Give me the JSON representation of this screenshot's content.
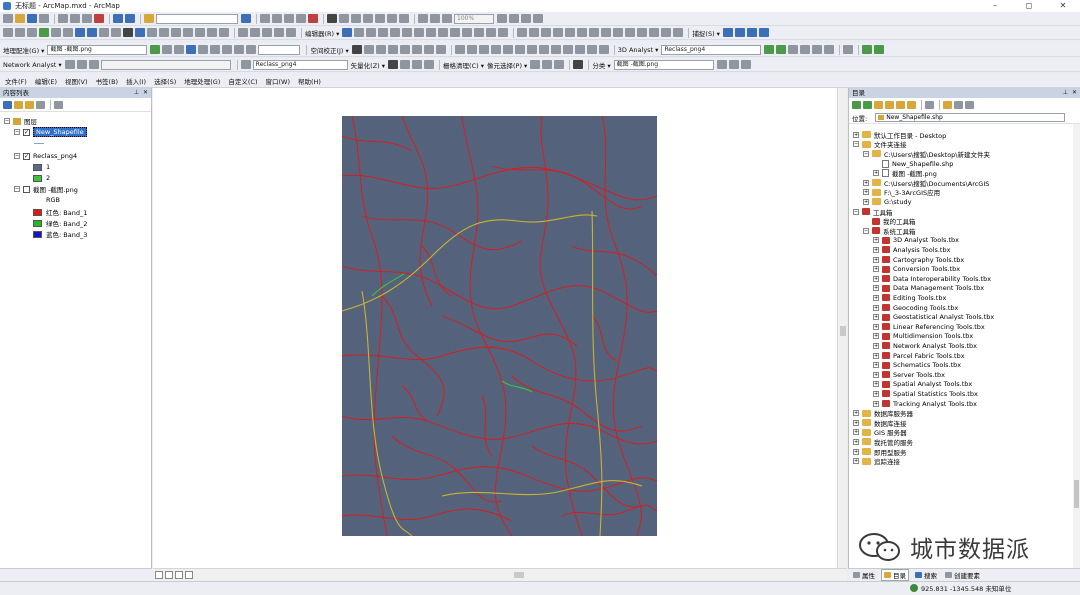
{
  "window": {
    "title": "无标题 - ArcMap.mxd - ArcMap",
    "controls": [
      "–",
      "◻",
      "✕"
    ]
  },
  "toolbar1": {
    "scale_box": "",
    "zoom_level": "100%"
  },
  "toolbar2": {
    "editor_label": "编辑器(R) ▾",
    "georef_label": "捕捉(S) ▾"
  },
  "toolbar3": {
    "georef_menu": "地理配准(G) ▾",
    "layer_box": "截图 -截图.png",
    "spatial_adjust": "空间校正(J) ▾",
    "analyst_3d": "3D Analyst ▾",
    "analyst_layer": "Reclass_png4"
  },
  "toolbar4": {
    "network_analyst": "Network Analyst ▾",
    "layer_box": "Reclass_png4",
    "vectorize": "矢量化(Z) ▾",
    "raster_cleanup": "栅格清理(C) ▾",
    "cell_select": "像元选择(P) ▾",
    "classify": "分类 ▾",
    "classify_layer": "截图 -截图.png"
  },
  "menubar": {
    "items": [
      "文件(F)",
      "编辑(E)",
      "视图(V)",
      "书签(B)",
      "插入(I)",
      "选择(S)",
      "地理处理(G)",
      "自定义(C)",
      "窗口(W)",
      "帮助(H)"
    ]
  },
  "toc": {
    "title": "内容列表",
    "layers_group": "图层",
    "layer1": "New_Shapefile",
    "layer2": "Reclass_png4",
    "layer2_classes": [
      {
        "label": "1",
        "color": "#5a6a86"
      },
      {
        "label": "2",
        "color": "#3dc43d"
      }
    ],
    "layer3": "截图 -截图.png",
    "rgb_label": "RGB",
    "bands": [
      {
        "label": "红色:    Band_1",
        "color": "#e01818"
      },
      {
        "label": "绿色:  Band_2",
        "color": "#22bb22"
      },
      {
        "label": "蓝色:    Band_3",
        "color": "#1414c8"
      }
    ]
  },
  "catalog": {
    "title": "目录",
    "location_label": "位置:",
    "location_value": "New_Shapefile.shp",
    "items": [
      {
        "label": "默认工作目录 - Desktop",
        "indent": 0,
        "icon": "folder",
        "exp": "+"
      },
      {
        "label": "文件夹连接",
        "indent": 0,
        "icon": "folder",
        "exp": "−"
      },
      {
        "label": "C:\\Users\\搜狐\\Desktop\\新建文件夹",
        "indent": 1,
        "icon": "folder",
        "exp": "−"
      },
      {
        "label": "New_Shapefile.shp",
        "indent": 2,
        "icon": "file",
        "exp": ""
      },
      {
        "label": "截图 -截图.png",
        "indent": 2,
        "icon": "file",
        "exp": "+"
      },
      {
        "label": "C:\\Users\\搜狐\\Documents\\ArcGIS",
        "indent": 1,
        "icon": "folder",
        "exp": "+"
      },
      {
        "label": "F:\\_3-3ArcGIS应用",
        "indent": 1,
        "icon": "folder",
        "exp": "+"
      },
      {
        "label": "G:\\study",
        "indent": 1,
        "icon": "folder",
        "exp": "+"
      },
      {
        "label": "工具箱",
        "indent": 0,
        "icon": "tbx",
        "exp": "−"
      },
      {
        "label": "我的工具箱",
        "indent": 1,
        "icon": "tbx",
        "exp": ""
      },
      {
        "label": "系统工具箱",
        "indent": 1,
        "icon": "tbx",
        "exp": "−"
      },
      {
        "label": "3D Analyst Tools.tbx",
        "indent": 2,
        "icon": "tbx",
        "exp": "+"
      },
      {
        "label": "Analysis Tools.tbx",
        "indent": 2,
        "icon": "tbx",
        "exp": "+"
      },
      {
        "label": "Cartography Tools.tbx",
        "indent": 2,
        "icon": "tbx",
        "exp": "+"
      },
      {
        "label": "Conversion Tools.tbx",
        "indent": 2,
        "icon": "tbx",
        "exp": "+"
      },
      {
        "label": "Data Interoperability Tools.tbx",
        "indent": 2,
        "icon": "tbx",
        "exp": "+"
      },
      {
        "label": "Data Management Tools.tbx",
        "indent": 2,
        "icon": "tbx",
        "exp": "+"
      },
      {
        "label": "Editing Tools.tbx",
        "indent": 2,
        "icon": "tbx",
        "exp": "+"
      },
      {
        "label": "Geocoding Tools.tbx",
        "indent": 2,
        "icon": "tbx",
        "exp": "+"
      },
      {
        "label": "Geostatistical Analyst Tools.tbx",
        "indent": 2,
        "icon": "tbx",
        "exp": "+"
      },
      {
        "label": "Linear Referencing Tools.tbx",
        "indent": 2,
        "icon": "tbx",
        "exp": "+"
      },
      {
        "label": "Multidimension Tools.tbx",
        "indent": 2,
        "icon": "tbx",
        "exp": "+"
      },
      {
        "label": "Network Analyst Tools.tbx",
        "indent": 2,
        "icon": "tbx",
        "exp": "+"
      },
      {
        "label": "Parcel Fabric Tools.tbx",
        "indent": 2,
        "icon": "tbx",
        "exp": "+"
      },
      {
        "label": "Schematics Tools.tbx",
        "indent": 2,
        "icon": "tbx",
        "exp": "+"
      },
      {
        "label": "Server Tools.tbx",
        "indent": 2,
        "icon": "tbx",
        "exp": "+"
      },
      {
        "label": "Spatial Analyst Tools.tbx",
        "indent": 2,
        "icon": "tbx",
        "exp": "+"
      },
      {
        "label": "Spatial Statistics Tools.tbx",
        "indent": 2,
        "icon": "tbx",
        "exp": "+"
      },
      {
        "label": "Tracking Analyst Tools.tbx",
        "indent": 2,
        "icon": "tbx",
        "exp": "+"
      },
      {
        "label": "数据库服务器",
        "indent": 0,
        "icon": "folder",
        "exp": "+"
      },
      {
        "label": "数据库连接",
        "indent": 0,
        "icon": "folder",
        "exp": "+"
      },
      {
        "label": "GIS 服务器",
        "indent": 0,
        "icon": "folder",
        "exp": "+"
      },
      {
        "label": "我托管的服务",
        "indent": 0,
        "icon": "folder",
        "exp": "+"
      },
      {
        "label": "即用型服务",
        "indent": 0,
        "icon": "folder",
        "exp": "+"
      },
      {
        "label": "追踪连接",
        "indent": 0,
        "icon": "folder",
        "exp": "+"
      }
    ],
    "tabs": [
      "属性",
      "目录",
      "搜索",
      "创建要素"
    ]
  },
  "status": {
    "coords": "925.831  -1345.548 未知单位"
  },
  "watermark": {
    "text": "城市数据派"
  },
  "colors": {
    "map_background": "#54627c",
    "road_red": "#e01818",
    "road_yellow": "#c8b432",
    "road_green": "#3dc43d"
  }
}
